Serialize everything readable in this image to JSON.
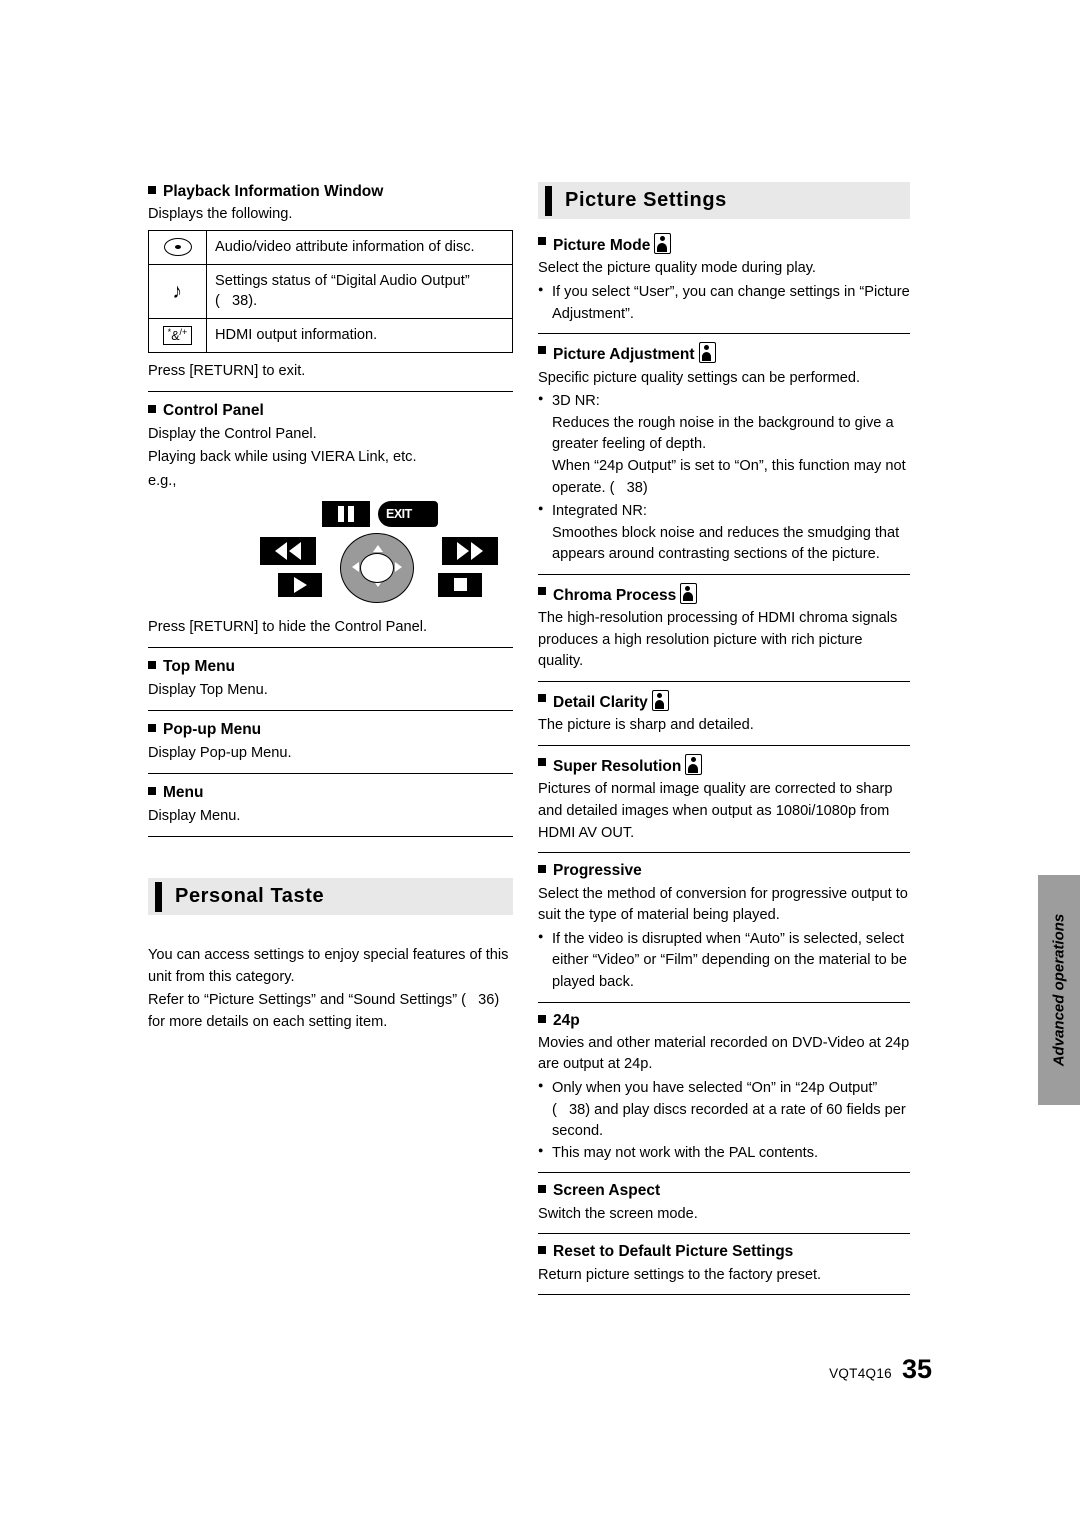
{
  "page": {
    "code": "VQT4Q16",
    "number": "35",
    "side_tab": "Advanced operations"
  },
  "left_column": {
    "playback_info": {
      "heading": "Playback Information Window",
      "intro": "Displays the following.",
      "rows": [
        {
          "icon": "disc-icon",
          "text": "Audio/video attribute information of disc."
        },
        {
          "icon": "audio-note-icon",
          "text": "Settings status of “Digital Audio Output” (   38)."
        },
        {
          "icon": "hdmi-icon",
          "text": "HDMI output information."
        }
      ],
      "outro": "Press [RETURN] to exit."
    },
    "control_panel": {
      "heading": "Control Panel",
      "line1": "Display the Control Panel.",
      "line2": "Playing back while using VIERA Link, etc.",
      "line3": "e.g.,",
      "diagram": {
        "pause_label": "pause-button",
        "exit_label": "EXIT",
        "rewind_label": "rewind-button",
        "forward_label": "fast-forward-button",
        "play_label": "play-button",
        "stop_label": "stop-button"
      },
      "outro": "Press [RETURN] to hide the Control Panel."
    },
    "top_menu": {
      "heading": "Top Menu",
      "text": "Display Top Menu."
    },
    "popup_menu": {
      "heading": "Pop-up Menu",
      "text": "Display Pop-up Menu."
    },
    "menu": {
      "heading": "Menu",
      "text": "Display Menu."
    },
    "personal_taste": {
      "banner": "Personal Taste",
      "p1": "You can access settings to enjoy special features of this unit from this category.",
      "p2": "Refer to “Picture Settings” and “Sound Settings” (   36) for more details on each setting item."
    }
  },
  "right_column": {
    "banner": "Picture Settings",
    "sections": [
      {
        "heading": "Picture Mode",
        "icon": true,
        "lines": [
          "Select the picture quality mode during play."
        ],
        "bullets": [
          "If you select “User”, you can change settings in “Picture Adjustment”."
        ]
      },
      {
        "heading": "Picture Adjustment",
        "icon": true,
        "lines": [
          "Specific picture quality settings can be performed."
        ],
        "bullets": [
          "3D NR:",
          "Integrated NR:"
        ],
        "sub": {
          "nr3d": "Reduces the rough noise in the background to give a greater feeling of depth.\nWhen “24p Output” is set to “On”, this function may not operate. (   38)",
          "integrated": "Smoothes block noise and reduces the smudging that appears around contrasting sections of the picture."
        }
      },
      {
        "heading": "Chroma Process",
        "icon": true,
        "lines": [
          "The high-resolution processing of HDMI chroma signals produces a high resolution picture with rich picture quality."
        ]
      },
      {
        "heading": "Detail Clarity",
        "icon": true,
        "lines": [
          "The picture is sharp and detailed."
        ]
      },
      {
        "heading": "Super Resolution",
        "icon": true,
        "lines": [
          "Pictures of normal image quality are corrected to sharp and detailed images when output as 1080i/1080p from HDMI AV OUT."
        ]
      },
      {
        "heading": "Progressive",
        "icon": false,
        "lines": [
          "Select the method of conversion for progressive output to suit the type of material being played."
        ],
        "bullets": [
          "If the video is disrupted when “Auto” is selected, select either “Video” or “Film” depending on the material to be played back."
        ]
      },
      {
        "heading": "24p",
        "icon": false,
        "lines": [
          "Movies and other material recorded on DVD-Video at 24p are output at 24p."
        ],
        "bullets": [
          "Only when you have selected “On” in “24p Output” (   38) and play discs recorded at a rate of 60 fields per second.",
          "This may not work with the PAL contents."
        ]
      },
      {
        "heading": "Screen Aspect",
        "icon": false,
        "lines": [
          "Switch the screen mode."
        ]
      },
      {
        "heading": "Reset to Default Picture Settings",
        "icon": false,
        "lines": [
          "Return picture settings to the factory preset."
        ]
      }
    ]
  }
}
